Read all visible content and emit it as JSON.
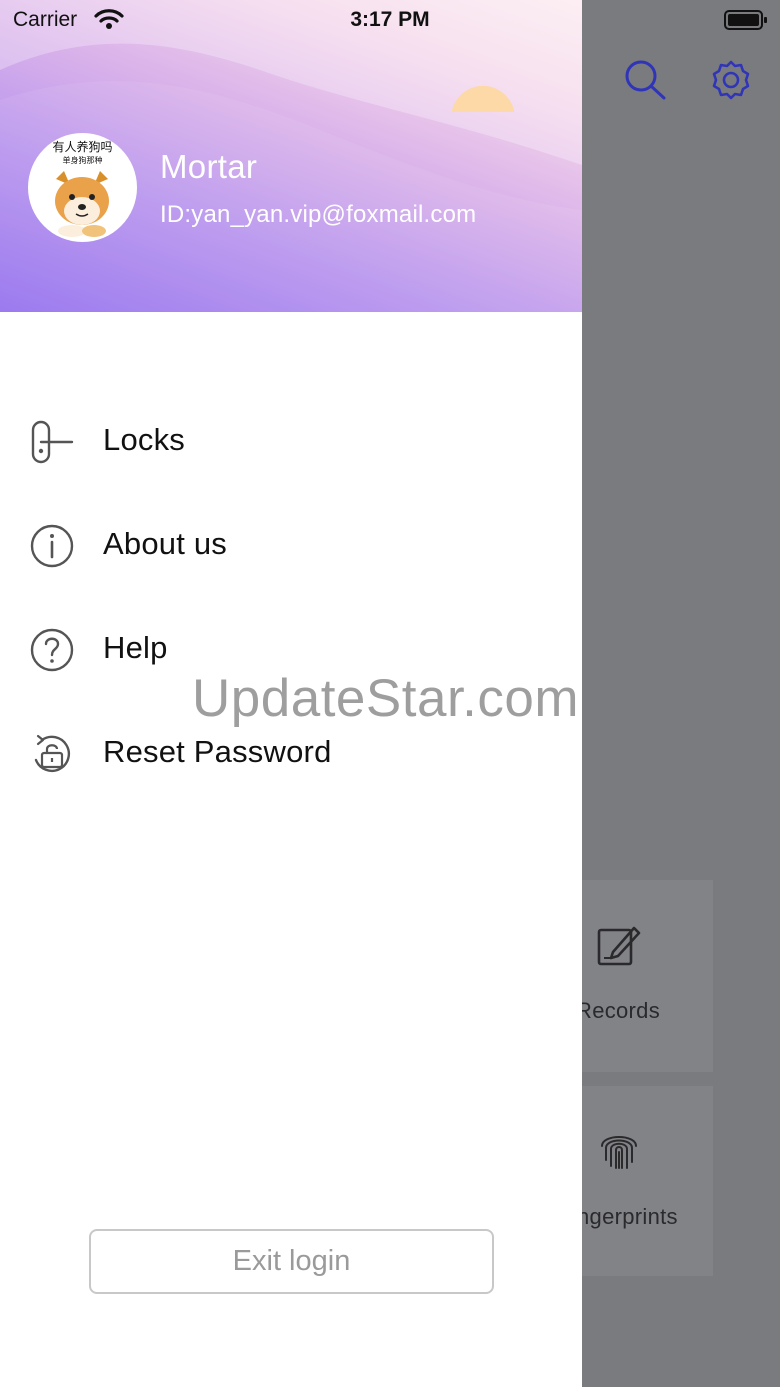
{
  "status_bar": {
    "carrier": "Carrier",
    "time": "3:17 PM"
  },
  "profile": {
    "name": "Mortar",
    "id_text": "ID:yan_yan.vip@foxmail.com",
    "avatar_caption_line1": "有人养狗吗",
    "avatar_caption_line2": "单身狗那种"
  },
  "menu": {
    "items": [
      {
        "label": "Locks",
        "icon": "lock-handle-icon"
      },
      {
        "label": "About us",
        "icon": "info-icon"
      },
      {
        "label": "Help",
        "icon": "help-icon"
      },
      {
        "label": "Reset Password",
        "icon": "reset-password-icon"
      }
    ]
  },
  "exit_button": {
    "label": "Exit login"
  },
  "background": {
    "cards": [
      {
        "label": "Records",
        "icon": "records-icon"
      },
      {
        "label": "ngerprints",
        "icon": "fingerprint-icon"
      }
    ]
  },
  "watermark": "UpdateStar.com",
  "colors": {
    "header_start": "#9471ee",
    "header_end": "#fbe9ee",
    "overlay": "#7a7b7f",
    "icon_accent": "#3b3fd0"
  }
}
